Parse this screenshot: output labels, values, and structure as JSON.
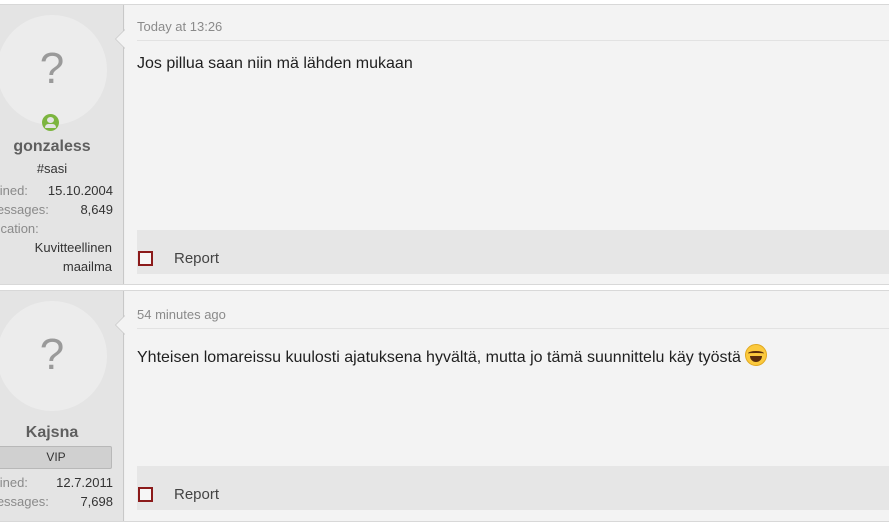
{
  "posts": [
    {
      "avatar": "?",
      "online": true,
      "username": "gonzaless",
      "user_title": "#sasi",
      "stats": [
        {
          "label": "Joined:",
          "value": "15.10.2004"
        },
        {
          "label": "Messages:",
          "value": "8,649"
        },
        {
          "label": "Location:",
          "value": ""
        }
      ],
      "location": [
        "Kuvitteellinen",
        "maailma"
      ],
      "time": "Today at 13:26",
      "message": "Jos pillua saan niin mä lähden mukaan",
      "report": "Report"
    },
    {
      "avatar": "?",
      "username": "Kajsna",
      "badge": "VIP",
      "stats": [
        {
          "label": "Joined:",
          "value": "12.7.2011"
        },
        {
          "label": "Messages:",
          "value": "7,698"
        }
      ],
      "time": "54 minutes ago",
      "message": "Yhteisen lomareissu kuulosti ajatuksena hyvältä, mutta jo tämä suunnittelu käy työstä",
      "emoji": "laughing-tears-emoji",
      "report": "Report"
    }
  ],
  "colors": {
    "online": "#7cb53f",
    "report_checkbox": "#8b1a1a"
  }
}
